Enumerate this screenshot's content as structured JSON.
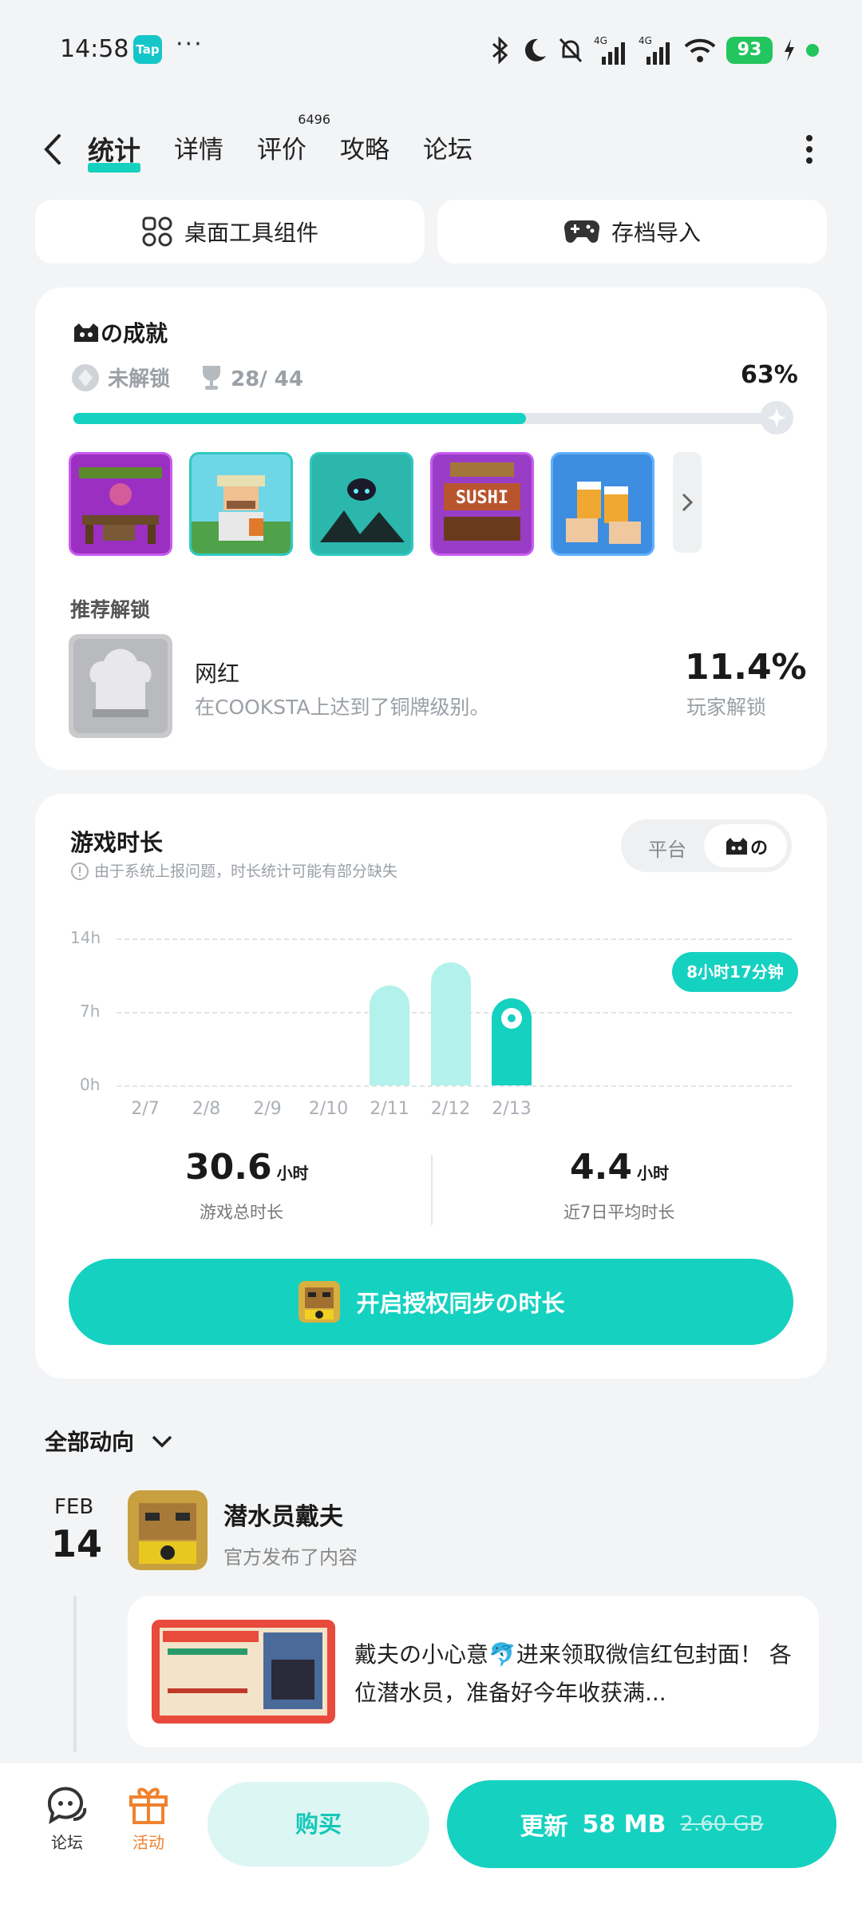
{
  "status_bar": {
    "time": "14:58",
    "app_badge": "Tap",
    "more": "···",
    "battery": "93"
  },
  "nav": {
    "tabs": [
      {
        "label": "统计",
        "active": true
      },
      {
        "label": "详情"
      },
      {
        "label": "评价",
        "count": "6496"
      },
      {
        "label": "攻略"
      },
      {
        "label": "论坛"
      }
    ]
  },
  "quick_actions": {
    "widgets": "桌面工具组件",
    "import": "存档导入"
  },
  "achievements": {
    "title": "の成就",
    "locked_label": "未解锁",
    "progress_text": "28/ 44",
    "percent": "63%",
    "progress": 0.63,
    "recommend_label": "推荐解锁",
    "rec_name": "网红",
    "rec_desc": "在COOKSTA上达到了铜牌级别。",
    "rec_percent": "11.4%",
    "rec_percent_label": "玩家解锁"
  },
  "playtime": {
    "title": "游戏时长",
    "note": "由于系统上报问题，时长统计可能有部分缺失",
    "seg_platform": "平台",
    "seg_game": "の",
    "tooltip": "8小时17分钟",
    "total_value": "30.6",
    "total_unit": "小时",
    "total_label": "游戏总时长",
    "avg_value": "4.4",
    "avg_unit": "小时",
    "avg_label": "近7日平均时长",
    "sync_button": "开启授权同步の时长"
  },
  "chart_data": {
    "type": "bar",
    "categories": [
      "2/7",
      "2/8",
      "2/9",
      "2/10",
      "2/11",
      "2/12",
      "2/13"
    ],
    "values": [
      0,
      0,
      0,
      0,
      9.5,
      11.7,
      8.28
    ],
    "y_ticks": [
      "0h",
      "7h",
      "14h"
    ],
    "ylim": [
      0,
      14
    ],
    "highlight_index": 6,
    "colors": {
      "normal": "#b3f1ec",
      "highlight": "#15d1c0"
    }
  },
  "feed": {
    "title": "全部动向",
    "month": "FEB",
    "day": "14",
    "author": "潜水员戴夫",
    "sub": "官方发布了内容",
    "post_text": "戴夫の小心意🐬进来领取微信红包封面！ 各位潜水员，准备好今年收获满..."
  },
  "bottom_bar": {
    "forum": "论坛",
    "activity": "活动",
    "buy": "购买",
    "update_label": "更新",
    "update_size": "58 MB",
    "full_size": "2.60 GB"
  },
  "colors": {
    "accent": "#15d1c0",
    "activity": "#f0812f"
  }
}
